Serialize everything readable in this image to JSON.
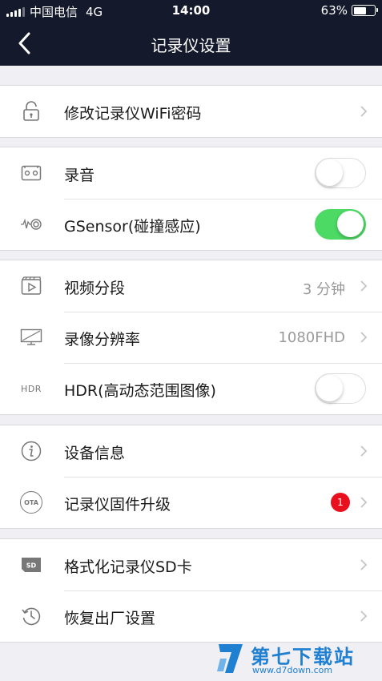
{
  "status_bar": {
    "carrier": "中国电信",
    "network": "4G",
    "time": "14:00",
    "battery_percent": "63%",
    "battery_level": 0.63
  },
  "nav": {
    "title": "记录仪设置",
    "back_icon": "chevron-left-icon"
  },
  "groups": [
    {
      "rows": [
        {
          "icon": "lock-icon",
          "label": "修改记录仪WiFi密码",
          "control": "chevron"
        }
      ]
    },
    {
      "rows": [
        {
          "icon": "cassette-icon",
          "label": "录音",
          "control": "toggle",
          "on": false
        },
        {
          "icon": "sensor-icon",
          "label": "GSensor(碰撞感应)",
          "control": "toggle",
          "on": true
        }
      ]
    },
    {
      "rows": [
        {
          "icon": "video-clip-icon",
          "label": "视频分段",
          "value": "3 分钟",
          "control": "chevron"
        },
        {
          "icon": "resolution-icon",
          "label": "录像分辨率",
          "value": "1080FHD",
          "control": "chevron"
        },
        {
          "icon": "hdr-icon",
          "icon_text": "HDR",
          "label": "HDR(高动态范围图像)",
          "control": "toggle",
          "on": false
        }
      ]
    },
    {
      "rows": [
        {
          "icon": "info-icon",
          "label": "设备信息",
          "control": "chevron"
        },
        {
          "icon": "ota-icon",
          "icon_text": "OTA",
          "label": "记录仪固件升级",
          "badge": "1",
          "control": "chevron"
        }
      ]
    },
    {
      "rows": [
        {
          "icon": "sd-card-icon",
          "icon_text": "SD",
          "label": "格式化记录仪SD卡",
          "control": "chevron"
        },
        {
          "icon": "restore-icon",
          "label": "恢复出厂设置",
          "control": "chevron"
        }
      ]
    }
  ],
  "watermark": {
    "name": "第七下载站",
    "url": "www.d7down.com"
  },
  "colors": {
    "header_bg": "#14192b",
    "toggle_on": "#4cd964",
    "badge": "#e8101c",
    "watermark": "#1f7fd0"
  }
}
